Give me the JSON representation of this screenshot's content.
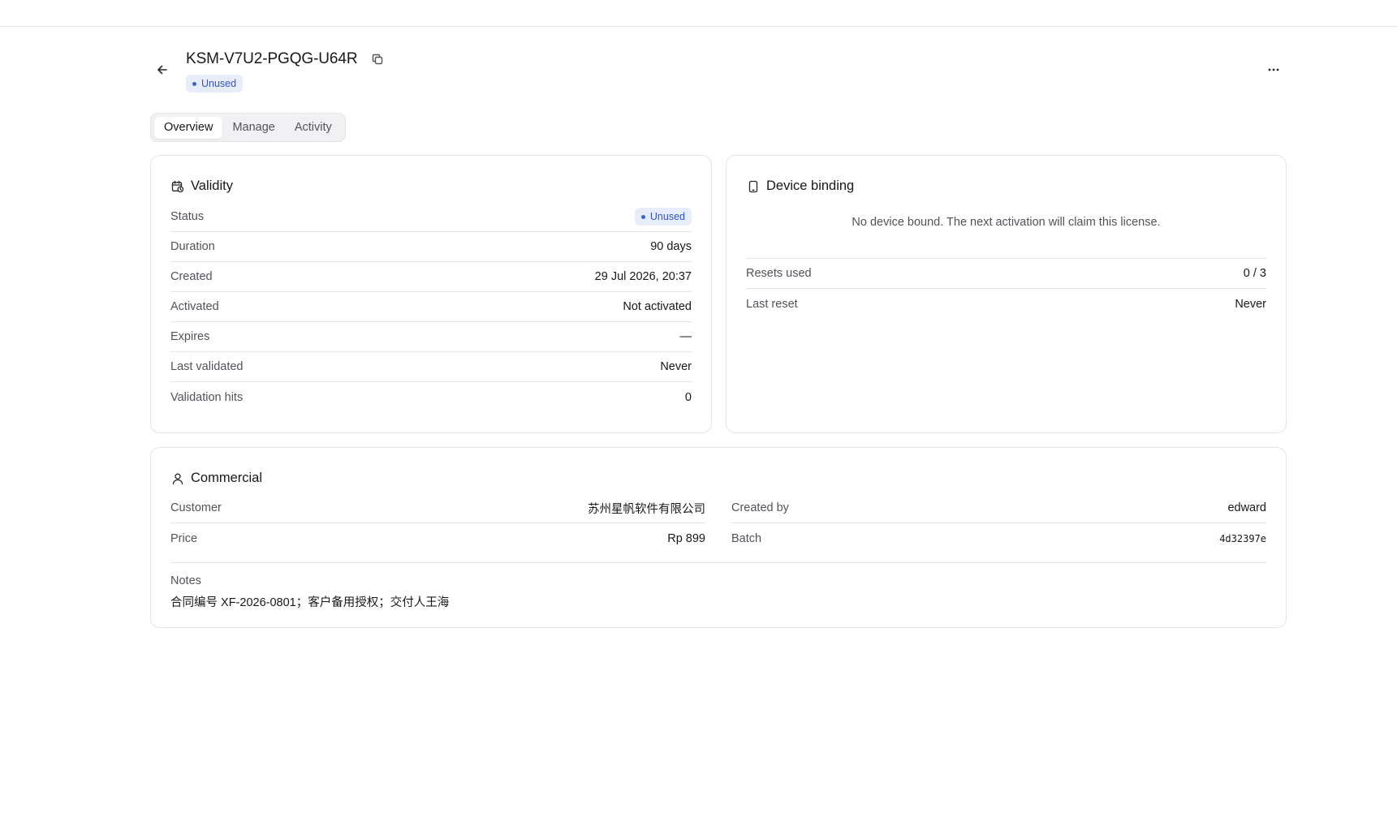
{
  "header": {
    "title": "KSM-V7U2-PGQG-U64R",
    "status_badge": "Unused"
  },
  "tabs": [
    {
      "label": "Overview",
      "active": true
    },
    {
      "label": "Manage",
      "active": false
    },
    {
      "label": "Activity",
      "active": false
    }
  ],
  "validity": {
    "title": "Validity",
    "rows": [
      {
        "label": "Status",
        "value": "Unused"
      },
      {
        "label": "Duration",
        "value": "90 days"
      },
      {
        "label": "Created",
        "value": "29 Jul 2026, 20:37"
      },
      {
        "label": "Activated",
        "value": "Not activated"
      },
      {
        "label": "Expires",
        "value": "—"
      },
      {
        "label": "Last validated",
        "value": "Never"
      },
      {
        "label": "Validation hits",
        "value": "0"
      }
    ]
  },
  "device_binding": {
    "title": "Device binding",
    "empty_message": "No device bound. The next activation will claim this license.",
    "rows": [
      {
        "label": "Resets used",
        "value": "0 / 3"
      },
      {
        "label": "Last reset",
        "value": "Never"
      }
    ]
  },
  "commercial": {
    "title": "Commercial",
    "left_rows": [
      {
        "label": "Customer",
        "value": "苏州星帆软件有限公司"
      },
      {
        "label": "Price",
        "value": "Rp 899"
      }
    ],
    "right_rows": [
      {
        "label": "Created by",
        "value": "edward"
      },
      {
        "label": "Batch",
        "value": "4d32397e"
      }
    ],
    "notes_label": "Notes",
    "notes_value": "合同编号 XF-2026-0801；客户备用授权；交付人王海"
  },
  "colors": {
    "badge_bg": "#e8edfb",
    "badge_text": "#2f55c9",
    "border": "#e4e4e7"
  }
}
